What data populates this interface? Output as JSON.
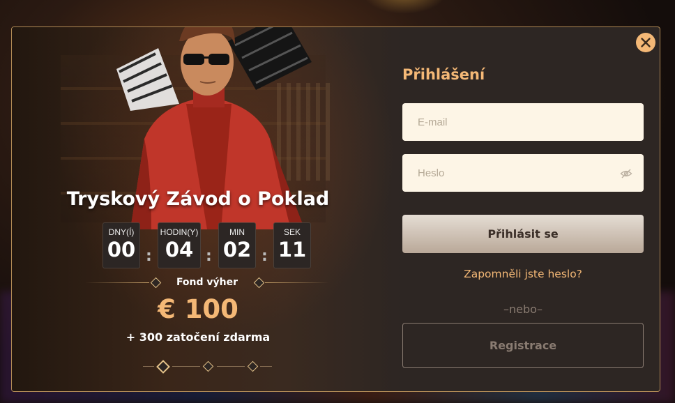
{
  "promo": {
    "title": "Tryskový Závod o Poklad",
    "countdown": [
      {
        "label": "DNY(Í)",
        "value": "00"
      },
      {
        "label": "HODIN(Y)",
        "value": "04"
      },
      {
        "label": "MIN",
        "value": "02"
      },
      {
        "label": "SEK",
        "value": "11"
      }
    ],
    "separator": ":",
    "fund_label": "Fond výher",
    "amount": "€ 100",
    "bonus": "+ 300 zatočení zdarma"
  },
  "login": {
    "title": "Přihlášení",
    "email_placeholder": "E-mail",
    "password_placeholder": "Heslo",
    "login_button": "Přihlásit se",
    "forgot_link": "Zapomněli jste heslo?",
    "or_text": "–nebo–",
    "register_button": "Registrace"
  },
  "icons": {
    "close": "close-icon",
    "password_visibility": "eye-off-icon"
  },
  "colors": {
    "accent": "#f4b876",
    "modal_bg": "#2d2623",
    "input_bg": "#fdf5e6",
    "border": "#b08a55"
  }
}
